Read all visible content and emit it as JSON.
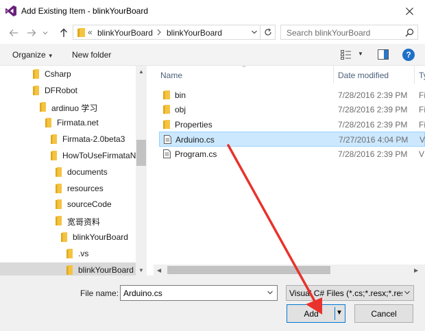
{
  "window": {
    "title": "Add Existing Item - blinkYourBoard",
    "icons": {
      "app": "visual-studio-icon",
      "close": "close-icon"
    }
  },
  "nav": {
    "address_overflow": "«",
    "path": [
      "blinkYourBoard",
      "blinkYourBoard"
    ],
    "search_placeholder": "Search blinkYourBoard"
  },
  "toolbar": {
    "organize_label": "Organize",
    "new_folder_label": "New folder",
    "help_label": "?"
  },
  "tree": {
    "items": [
      {
        "label": "Csharp",
        "indent": 0
      },
      {
        "label": "DFRobot",
        "indent": 0
      },
      {
        "label": "ardinuo 学习",
        "indent": 1
      },
      {
        "label": "Firmata.net",
        "indent": 2
      },
      {
        "label": "Firmata-2.0beta3",
        "indent": 3
      },
      {
        "label": "HowToUseFirmataNet",
        "indent": 3
      },
      {
        "label": "documents",
        "indent": 4
      },
      {
        "label": "resources",
        "indent": 4
      },
      {
        "label": "sourceCode",
        "indent": 4
      },
      {
        "label": "宽哥资料",
        "indent": 4
      },
      {
        "label": "blinkYourBoard",
        "indent": 5
      },
      {
        "label": ".vs",
        "indent": 6
      },
      {
        "label": "blinkYourBoard",
        "indent": 6
      }
    ],
    "selected_index": 12
  },
  "list": {
    "columns": [
      "Name",
      "Date modified",
      "Ty"
    ],
    "rows": [
      {
        "name": "bin",
        "icon": "folder-icon",
        "date": "7/28/2016 2:39 PM",
        "type": "Fi"
      },
      {
        "name": "obj",
        "icon": "folder-icon",
        "date": "7/28/2016 2:39 PM",
        "type": "Fi"
      },
      {
        "name": "Properties",
        "icon": "folder-icon",
        "date": "7/28/2016 2:39 PM",
        "type": "Fi"
      },
      {
        "name": "Arduino.cs",
        "icon": "file-icon",
        "date": "7/27/2016 4:04 PM",
        "type": "V"
      },
      {
        "name": "Program.cs",
        "icon": "file-icon",
        "date": "7/28/2016 2:39 PM",
        "type": "V"
      }
    ],
    "selected_index": 3
  },
  "footer": {
    "file_name_label": "File name:",
    "file_name_value": "Arduino.cs",
    "file_type_value": "Visual C# Files (*.cs;*.resx;*.resw;",
    "add_label": "Add",
    "cancel_label": "Cancel"
  },
  "colors": {
    "selection": "#cce8ff",
    "accent": "#0078d7",
    "folder": "#f5c342",
    "annotation_arrow": "#e8322b"
  }
}
